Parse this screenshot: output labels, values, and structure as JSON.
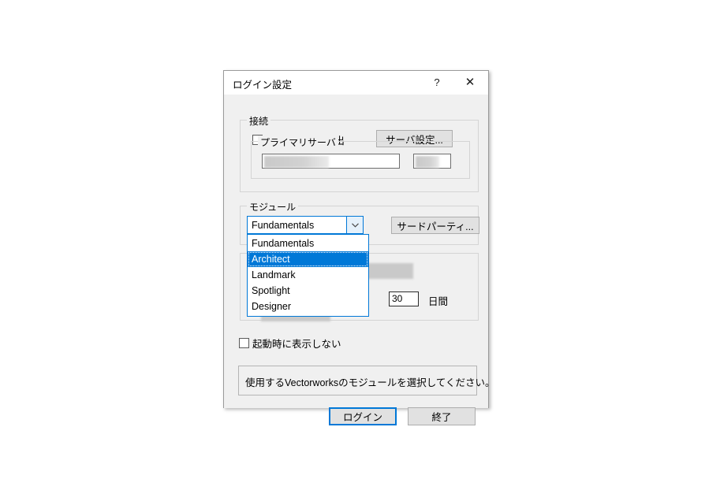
{
  "window": {
    "title": "ログイン設定",
    "help_label": "?",
    "close_label": "✕"
  },
  "connection": {
    "group_label": "接続",
    "auto_detect_label": "サーバを自動検出",
    "auto_detect_checked": false,
    "server_settings_button": "サーバ設定...",
    "primary_server": {
      "group_label": "プライマリサーバ",
      "field_value": "",
      "field_placeholder": "",
      "port_value": ""
    }
  },
  "module": {
    "group_label": "モジュール",
    "selected": "Fundamentals",
    "third_party_button": "サードパーティ...",
    "options": [
      "Fundamentals",
      "Architect",
      "Landmark",
      "Spotlight",
      "Designer"
    ],
    "highlighted_option": "Architect"
  },
  "license": {
    "days_value": "30",
    "days_unit_label": "日間"
  },
  "options": {
    "hide_on_startup_label": "起動時に表示しない",
    "hide_on_startup_checked": false
  },
  "status": {
    "message": "使用するVectorworksのモジュールを選択してください。"
  },
  "actions": {
    "login_button": "ログイン",
    "quit_button": "終了"
  },
  "colors": {
    "accent": "#0078d7",
    "dialog_bg": "#f0f0f0",
    "button_bg": "#e1e1e1"
  }
}
